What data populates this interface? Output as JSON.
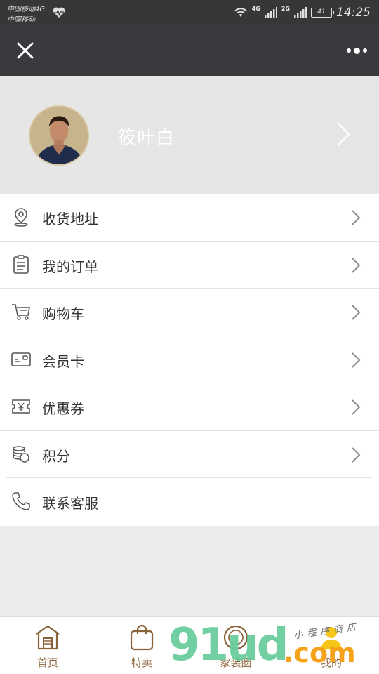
{
  "status_bar": {
    "carrier_line1": "中国移动4G",
    "carrier_line2": "中国移动",
    "net1": "4G",
    "net2": "2G",
    "battery": "41",
    "time": "14:25"
  },
  "title_bar": {
    "close_icon": "close-icon",
    "more_icon": "more-dots-icon"
  },
  "profile": {
    "name": "筱叶白"
  },
  "menu": {
    "items": [
      {
        "label": "收货地址",
        "icon": "location-pin-icon",
        "has_arrow": true
      },
      {
        "label": "我的订单",
        "icon": "order-list-icon",
        "has_arrow": true
      },
      {
        "label": "购物车",
        "icon": "cart-icon",
        "has_arrow": true
      },
      {
        "label": "会员卡",
        "icon": "member-card-icon",
        "has_arrow": true
      },
      {
        "label": "优惠券",
        "icon": "coupon-icon",
        "has_arrow": true
      },
      {
        "label": "积分",
        "icon": "points-coins-icon",
        "has_arrow": true
      },
      {
        "label": "联系客服",
        "icon": "phone-icon",
        "has_arrow": false
      }
    ]
  },
  "tabbar": {
    "tabs": [
      {
        "label": "首页",
        "icon": "home-icon"
      },
      {
        "label": "特卖",
        "icon": "shopping-bag-icon"
      },
      {
        "label": "家装圈",
        "icon": "circle-icon"
      },
      {
        "label": "我的",
        "icon": "profile-icon"
      }
    ]
  },
  "watermark": {
    "big": "91ud",
    "com": ".com",
    "small": "小程序商店"
  },
  "colors": {
    "status_bar": "#373737",
    "title_bar": "#393a3e",
    "profile_bg": "#e6e6e6",
    "tab_label": "#8a6238",
    "page_bg": "#ececec"
  }
}
